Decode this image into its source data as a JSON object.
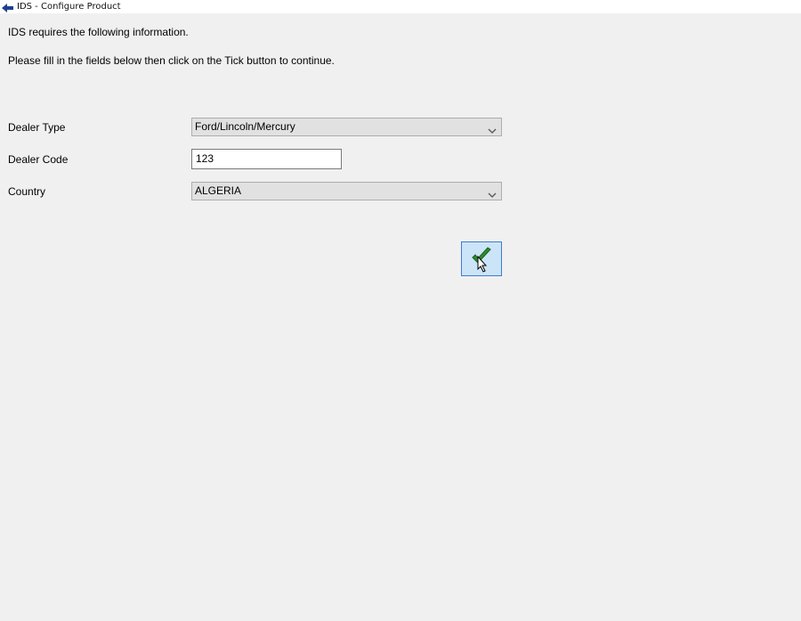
{
  "window": {
    "title": "IDS - Configure Product"
  },
  "instructions": {
    "line1": "IDS requires the following information.",
    "line2": "Please fill in the fields below then click on the Tick button to continue."
  },
  "form": {
    "dealer_type": {
      "label": "Dealer Type",
      "value": "Ford/Lincoln/Mercury"
    },
    "dealer_code": {
      "label": "Dealer Code",
      "value": "123"
    },
    "country": {
      "label": "Country",
      "value": "ALGERIA"
    }
  },
  "tick_button": {
    "icon": "checkmark-icon",
    "color": "#2e8b2e"
  }
}
